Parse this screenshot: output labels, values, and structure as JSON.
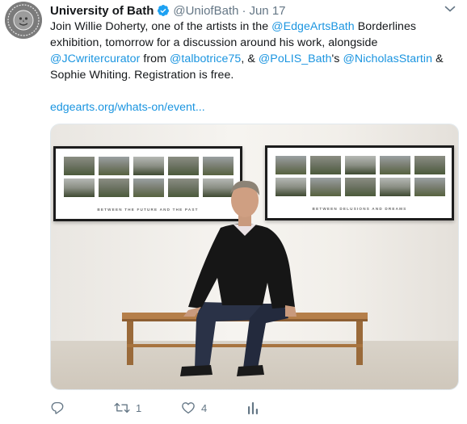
{
  "tweet": {
    "author_name": "University of Bath",
    "author_handle": "@UniofBath",
    "separator": "·",
    "timestamp": "Jun 17",
    "text": {
      "t1": "Join Willie Doherty, one of the artists in the ",
      "m1": "@EdgeArtsBath",
      "t2": " Borderlines exhibition, tomorrow for a discussion around his work, alongside ",
      "m2": "@JCwritercurator",
      "t3": " from ",
      "m3": "@talbotrice75",
      "t4": ", & ",
      "m4": "@PoLIS_Bath",
      "t5": "'s ",
      "m5": "@NicholasStartin",
      "t6": " & Sophie Whiting. Registration is free."
    },
    "link": "edgearts.org/whats-on/event...",
    "media": {
      "left_frame_caption": "BETWEEN THE FUTURE AND THE PAST",
      "right_frame_caption": "BETWEEN DELUSIONS AND DREAMS"
    },
    "stats": {
      "replies": "",
      "retweets": "1",
      "likes": "4"
    }
  },
  "icons": {
    "avatar": "university-seal-icon",
    "verified": "verified-badge-icon",
    "caret": "chevron-down-icon",
    "reply": "reply-icon",
    "retweet": "retweet-icon",
    "like": "heart-icon",
    "analytics": "analytics-icon"
  },
  "colors": {
    "link": "#1b95e0",
    "secondary_text": "#657786",
    "verified": "#1da1f2"
  }
}
